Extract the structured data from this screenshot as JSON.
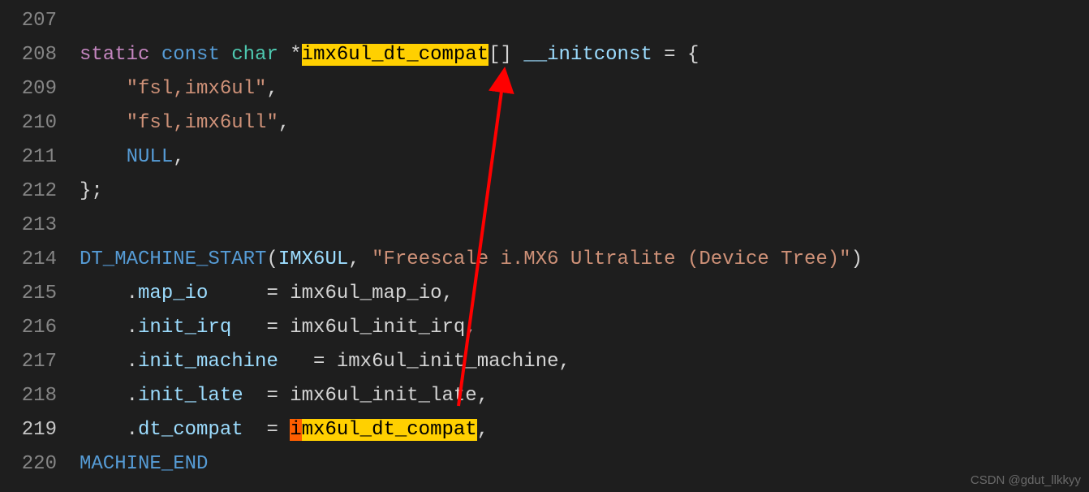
{
  "watermark": "CSDN @gdut_llkkyy",
  "lines": [
    {
      "num": "207",
      "tokens": []
    },
    {
      "num": "208",
      "tokens": [
        {
          "t": "static",
          "cls": "kw-static"
        },
        {
          "t": " ",
          "cls": ""
        },
        {
          "t": "const",
          "cls": "kw-const"
        },
        {
          "t": " ",
          "cls": ""
        },
        {
          "t": "char",
          "cls": "kw-char"
        },
        {
          "t": " *",
          "cls": "punct"
        },
        {
          "t": "imx6ul_dt_compat",
          "cls": "hl"
        },
        {
          "t": "[] ",
          "cls": "punct"
        },
        {
          "t": "__initconst",
          "cls": "initc"
        },
        {
          "t": " = {",
          "cls": "punct"
        }
      ]
    },
    {
      "num": "209",
      "tokens": [
        {
          "t": "    ",
          "cls": ""
        },
        {
          "t": "\"fsl,imx6ul\"",
          "cls": "str"
        },
        {
          "t": ",",
          "cls": "punct"
        }
      ]
    },
    {
      "num": "210",
      "tokens": [
        {
          "t": "    ",
          "cls": ""
        },
        {
          "t": "\"fsl,imx6ull\"",
          "cls": "str"
        },
        {
          "t": ",",
          "cls": "punct"
        }
      ]
    },
    {
      "num": "211",
      "tokens": [
        {
          "t": "    ",
          "cls": ""
        },
        {
          "t": "NULL",
          "cls": "kw-null"
        },
        {
          "t": ",",
          "cls": "punct"
        }
      ]
    },
    {
      "num": "212",
      "tokens": [
        {
          "t": "};",
          "cls": "punct"
        }
      ]
    },
    {
      "num": "213",
      "tokens": []
    },
    {
      "num": "214",
      "tokens": [
        {
          "t": "DT_MACHINE_START",
          "cls": "macro"
        },
        {
          "t": "(",
          "cls": "punct"
        },
        {
          "t": "IMX6UL",
          "cls": "param"
        },
        {
          "t": ", ",
          "cls": "punct"
        },
        {
          "t": "\"Freescale i.MX6 Ultralite (Device Tree)\"",
          "cls": "str"
        },
        {
          "t": ")",
          "cls": "punct"
        }
      ]
    },
    {
      "num": "215",
      "tokens": [
        {
          "t": "    .",
          "cls": "punct"
        },
        {
          "t": "map_io",
          "cls": "field"
        },
        {
          "t": "     = ",
          "cls": "punct"
        },
        {
          "t": "imx6ul_map_io",
          "cls": "ident"
        },
        {
          "t": ",",
          "cls": "punct"
        }
      ]
    },
    {
      "num": "216",
      "tokens": [
        {
          "t": "    .",
          "cls": "punct"
        },
        {
          "t": "init_irq",
          "cls": "field"
        },
        {
          "t": "   = ",
          "cls": "punct"
        },
        {
          "t": "imx6ul_init_irq",
          "cls": "ident"
        },
        {
          "t": ",",
          "cls": "punct"
        }
      ]
    },
    {
      "num": "217",
      "tokens": [
        {
          "t": "    .",
          "cls": "punct"
        },
        {
          "t": "init_machine",
          "cls": "field"
        },
        {
          "t": "   = ",
          "cls": "punct"
        },
        {
          "t": "imx6ul_init_machine",
          "cls": "ident"
        },
        {
          "t": ",",
          "cls": "punct"
        }
      ]
    },
    {
      "num": "218",
      "tokens": [
        {
          "t": "    .",
          "cls": "punct"
        },
        {
          "t": "init_late",
          "cls": "field"
        },
        {
          "t": "  = ",
          "cls": "punct"
        },
        {
          "t": "imx6ul_init_late",
          "cls": "ident"
        },
        {
          "t": ",",
          "cls": "punct"
        }
      ]
    },
    {
      "num": "219",
      "active": true,
      "tokens": [
        {
          "t": "    .",
          "cls": "punct"
        },
        {
          "t": "dt_compat",
          "cls": "field"
        },
        {
          "t": "  = ",
          "cls": "punct"
        },
        {
          "t": "i",
          "cls": "cursor-hl"
        },
        {
          "t": "mx6ul_dt_compat",
          "cls": "hl2"
        },
        {
          "t": ",",
          "cls": "punct"
        }
      ]
    },
    {
      "num": "220",
      "tokens": [
        {
          "t": "MACHINE_END",
          "cls": "macroend"
        }
      ]
    }
  ],
  "arrow": {
    "color": "#ff0000"
  }
}
